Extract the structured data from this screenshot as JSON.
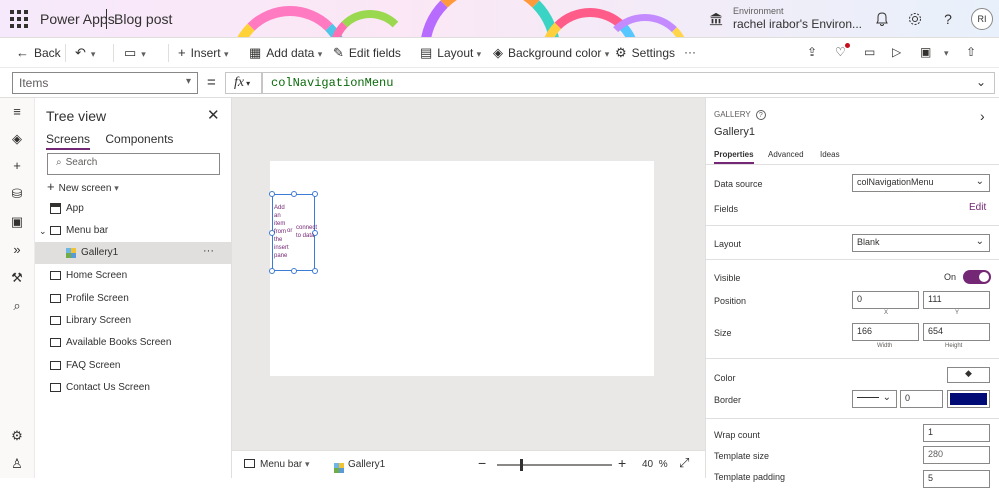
{
  "titlebar": {
    "app_name": "Power Apps",
    "doc_title": "Blog post",
    "env_label": "Environment",
    "env_name": "rachel irabor's Environ...",
    "avatar_initials": "RI"
  },
  "cmdbar": {
    "back": "Back",
    "insert": "Insert",
    "add_data": "Add data",
    "edit_fields": "Edit fields",
    "layout": "Layout",
    "background_color": "Background color",
    "settings": "Settings",
    "more": "···"
  },
  "formula": {
    "property": "Items",
    "equals": "=",
    "fx": "fx",
    "expression": "colNavigationMenu"
  },
  "tree": {
    "title": "Tree view",
    "tabs": [
      "Screens",
      "Components"
    ],
    "search_placeholder": "Search",
    "new_screen": "New screen",
    "items": [
      {
        "label": "App"
      },
      {
        "label": "Menu bar"
      },
      {
        "label": "Gallery1"
      },
      {
        "label": "Home Screen"
      },
      {
        "label": "Profile Screen"
      },
      {
        "label": "Library Screen"
      },
      {
        "label": "Available Books Screen"
      },
      {
        "label": "FAQ Screen"
      },
      {
        "label": "Contact Us Screen"
      }
    ],
    "ellipsis": "···"
  },
  "canvas": {
    "gallery_hint_left": "Add an item from the insert pane",
    "gallery_hint_or": "or",
    "gallery_hint_right": "connect to data"
  },
  "bottombar": {
    "screen": "Menu bar",
    "control": "Gallery1",
    "zoom": "40",
    "zoom_unit": "%"
  },
  "props": {
    "type": "GALLERY",
    "name": "Gallery1",
    "tabs": [
      "Properties",
      "Advanced",
      "Ideas"
    ],
    "data_source_label": "Data source",
    "data_source_value": "colNavigationMenu",
    "fields_label": "Fields",
    "fields_edit": "Edit",
    "layout_label": "Layout",
    "layout_value": "Blank",
    "visible_label": "Visible",
    "visible_value": "On",
    "position_label": "Position",
    "position_x": "0",
    "position_y": "111",
    "x_label": "X",
    "y_label": "Y",
    "size_label": "Size",
    "size_width": "166",
    "size_height": "654",
    "width_label": "Width",
    "height_label": "Height",
    "color_label": "Color",
    "border_label": "Border",
    "border_width": "0",
    "border_color": "#000b75",
    "wrap_count_label": "Wrap count",
    "wrap_count_value": "1",
    "template_size_label": "Template size",
    "template_size_value": "280",
    "template_padding_label": "Template padding",
    "template_padding_value": "5"
  },
  "colors": {
    "accent": "#742774",
    "selection": "#3d7ad6"
  }
}
